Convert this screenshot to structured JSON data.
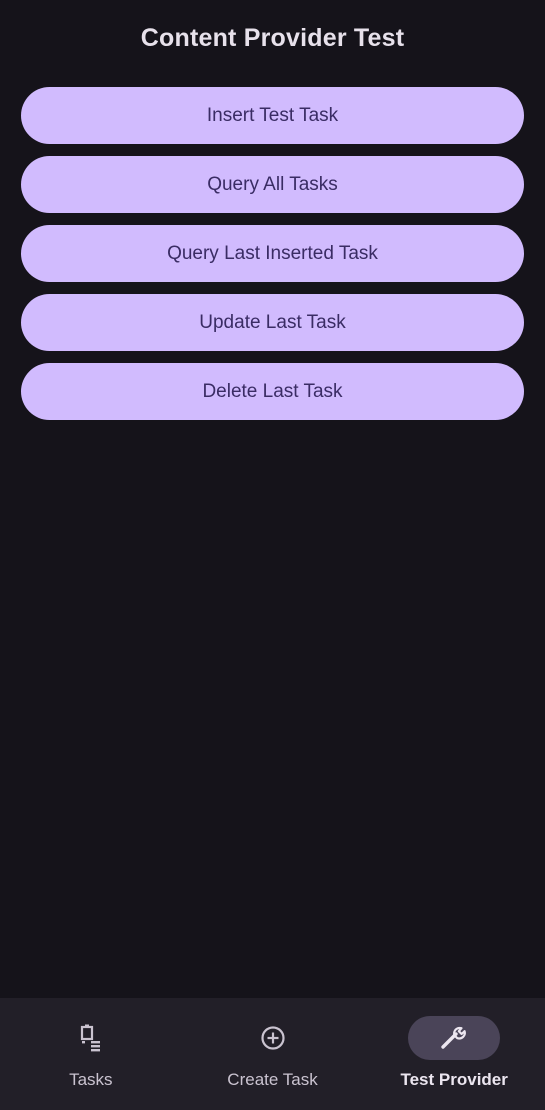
{
  "header": {
    "title": "Content Provider Test"
  },
  "actions": [
    {
      "label": "Insert Test Task"
    },
    {
      "label": "Query All Tasks"
    },
    {
      "label": "Query Last Inserted Task"
    },
    {
      "label": "Update Last Task"
    },
    {
      "label": "Delete Last Task"
    }
  ],
  "bottom_nav": {
    "items": [
      {
        "label": "Tasks",
        "icon": "task-list-icon",
        "active": false
      },
      {
        "label": "Create Task",
        "icon": "add-circle-icon",
        "active": false
      },
      {
        "label": "Test Provider",
        "icon": "wrench-icon",
        "active": true
      }
    ]
  },
  "colors": {
    "background": "#15131a",
    "button_fill": "#d1bbfe",
    "button_text": "#3a2c64",
    "nav_background": "#221f28",
    "nav_active_pill": "#4a4458"
  }
}
